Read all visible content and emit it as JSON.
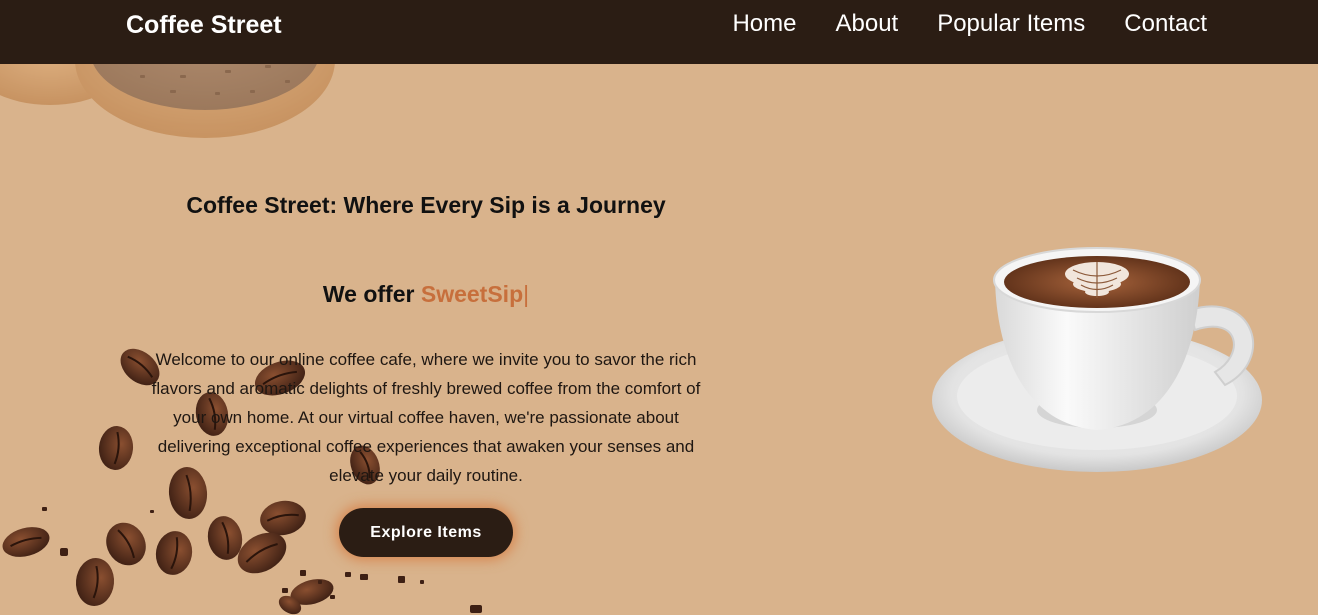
{
  "header": {
    "brand": "Coffee Street",
    "nav": [
      {
        "label": "Home"
      },
      {
        "label": "About"
      },
      {
        "label": "Popular Items"
      },
      {
        "label": "Contact"
      }
    ]
  },
  "hero": {
    "title": "Coffee Street: Where Every Sip is a Journey",
    "offer_prefix": "We offer ",
    "offer_highlight": "SweetSip",
    "offer_cursor": "|",
    "description": "Welcome to our online coffee cafe, where we invite you to savor the rich flavors and aromatic delights of freshly brewed coffee from the comfort of your own home. At our virtual coffee haven, we're passionate about delivering exceptional coffee experiences that awaken your senses and elevate your daily routine.",
    "button_label": "Explore Items"
  },
  "colors": {
    "background": "#d9b38c",
    "navbar": "#2b1d14",
    "accent": "#c76f3c",
    "button": "#2b1d14"
  },
  "decorations": {
    "top_left": "donut-image",
    "bottom_left": "coffee-beans-image",
    "right": "coffee-cup-image"
  }
}
